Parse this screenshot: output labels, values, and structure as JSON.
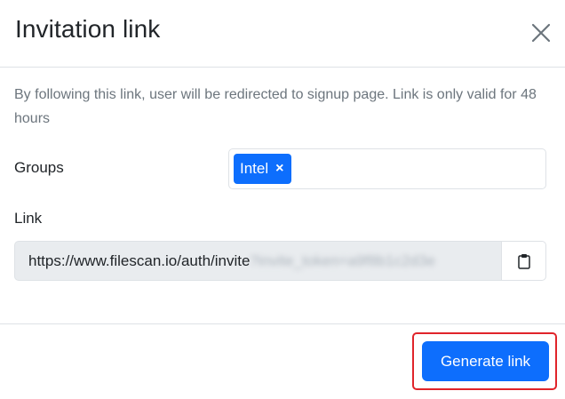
{
  "modal": {
    "title": "Invitation link",
    "description": "By following this link, user will be redirected to signup page. Link is only valid for 48 hours"
  },
  "groups": {
    "label": "Groups",
    "selected": [
      {
        "label": "Intel",
        "remove_glyph": "×"
      }
    ]
  },
  "link": {
    "label": "Link",
    "url_visible": "https://www.filescan.io/auth/invite",
    "url_obscured": "?invite_token=a9f8b1c2d3e"
  },
  "footer": {
    "generate_label": "Generate link"
  },
  "icons": {
    "close": "close-icon",
    "copy": "clipboard-icon"
  },
  "colors": {
    "primary": "#0d6efd",
    "highlight": "#e0242a",
    "muted_text": "#6c757d",
    "field_bg": "#e9ecef",
    "border": "#dee2e6"
  }
}
